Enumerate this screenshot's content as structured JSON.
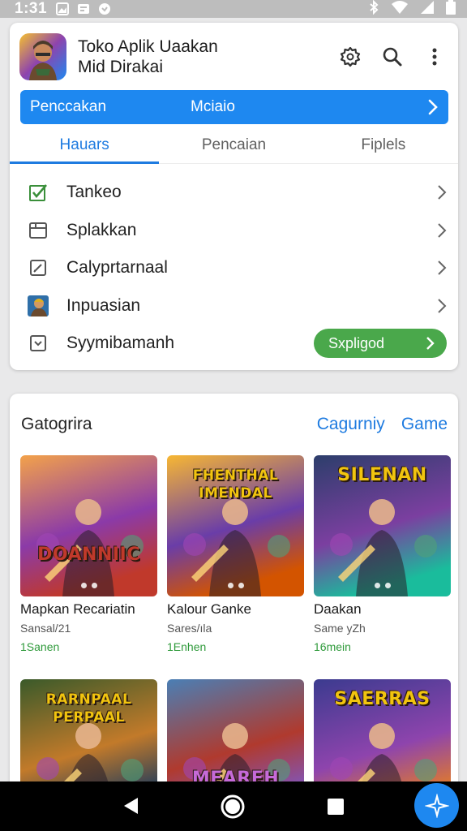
{
  "status": {
    "time": "1:31"
  },
  "app": {
    "title_line1": "Toko Aplik Uaakan",
    "title_line2": "Mid Dirakai"
  },
  "bluebar": {
    "left_label": "Penccakan",
    "mid_label": "Mciaio"
  },
  "tabs": [
    {
      "label": "Hauars",
      "active": true
    },
    {
      "label": "Pencaian",
      "active": false
    },
    {
      "label": "Fiplels",
      "active": false
    }
  ],
  "menu": [
    {
      "label": "Tankeo",
      "icon": "checkbox-checked-icon"
    },
    {
      "label": "Splakkan",
      "icon": "folder-icon"
    },
    {
      "label": "Calyprtarnaal",
      "icon": "edit-box-icon"
    },
    {
      "label": "Inpuasian",
      "icon": "avatar-icon"
    },
    {
      "label": "Syymibamanh",
      "icon": "checkbox-down-icon",
      "pill_label": "Sxpligod"
    }
  ],
  "section": {
    "title": "Gatogrira",
    "link1": "Cagurniy",
    "link2": "Game"
  },
  "games": [
    {
      "name": "Mapkan Recariatin",
      "sub": "Sansal/21",
      "size": "1Sanen",
      "art_text": "DOANNIIC",
      "colors": [
        "#f3a24a",
        "#8b3aa8",
        "#c0392b"
      ]
    },
    {
      "name": "Kalour Ganke",
      "sub": "Sares/ıla",
      "size": "1Enhen",
      "art_text": "FHENTHAL IMENDAL",
      "colors": [
        "#f7b733",
        "#6a3da8",
        "#d35400"
      ]
    },
    {
      "name": "Daakan",
      "sub": "Same yZh",
      "size": "16mein",
      "art_text": "SILENAN",
      "colors": [
        "#2c3e6b",
        "#7b3fa0",
        "#1abc9c"
      ]
    },
    {
      "name": "",
      "sub": "",
      "size": "",
      "art_text": "RARNPAAL PERPAAL",
      "colors": [
        "#3a5a2a",
        "#c27a2a",
        "#1f3b5c"
      ]
    },
    {
      "name": "",
      "sub": "",
      "size": "",
      "art_text": "MEAREH",
      "colors": [
        "#4a7fb5",
        "#b03a2e",
        "#7e57c2"
      ]
    },
    {
      "name": "",
      "sub": "",
      "size": "",
      "art_text": "SAERRAS",
      "colors": [
        "#3b3b8f",
        "#8e44ad",
        "#e67e22"
      ]
    }
  ],
  "colors": {
    "accent": "#1e88f0",
    "tab_active": "#1e7be0",
    "pill": "#4aa84b",
    "size_text": "#2f9a3b"
  }
}
